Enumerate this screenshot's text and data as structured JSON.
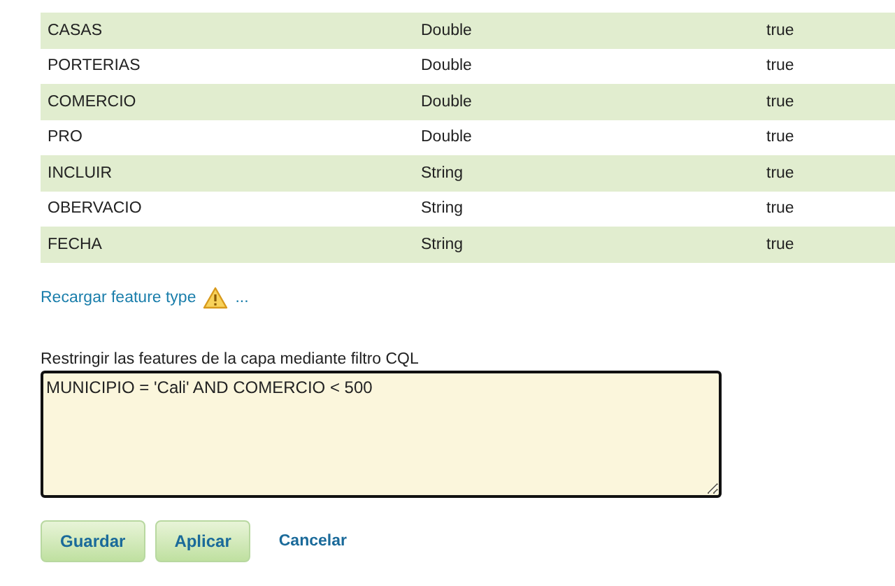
{
  "table": {
    "rows": [
      {
        "name": "CASAS",
        "type": "Double",
        "nillable": "true"
      },
      {
        "name": "PORTERIAS",
        "type": "Double",
        "nillable": "true"
      },
      {
        "name": "COMERCIO",
        "type": "Double",
        "nillable": "true"
      },
      {
        "name": "PRO",
        "type": "Double",
        "nillable": "true"
      },
      {
        "name": "INCLUIR",
        "type": "String",
        "nillable": "true"
      },
      {
        "name": "OBERVACIO",
        "type": "String",
        "nillable": "true"
      },
      {
        "name": "FECHA",
        "type": "String",
        "nillable": "true"
      }
    ]
  },
  "reload_link": {
    "label": "Recargar feature type",
    "ellipsis": "..."
  },
  "cql_filter": {
    "label": "Restringir las features de la capa mediante filtro CQL",
    "value": "MUNICIPIO = 'Cali' AND COMERCIO < 500"
  },
  "buttons": [
    {
      "label": "Guardar",
      "kind": "primary"
    },
    {
      "label": "Aplicar",
      "kind": "primary"
    },
    {
      "label": "Cancelar",
      "kind": "link"
    }
  ]
}
